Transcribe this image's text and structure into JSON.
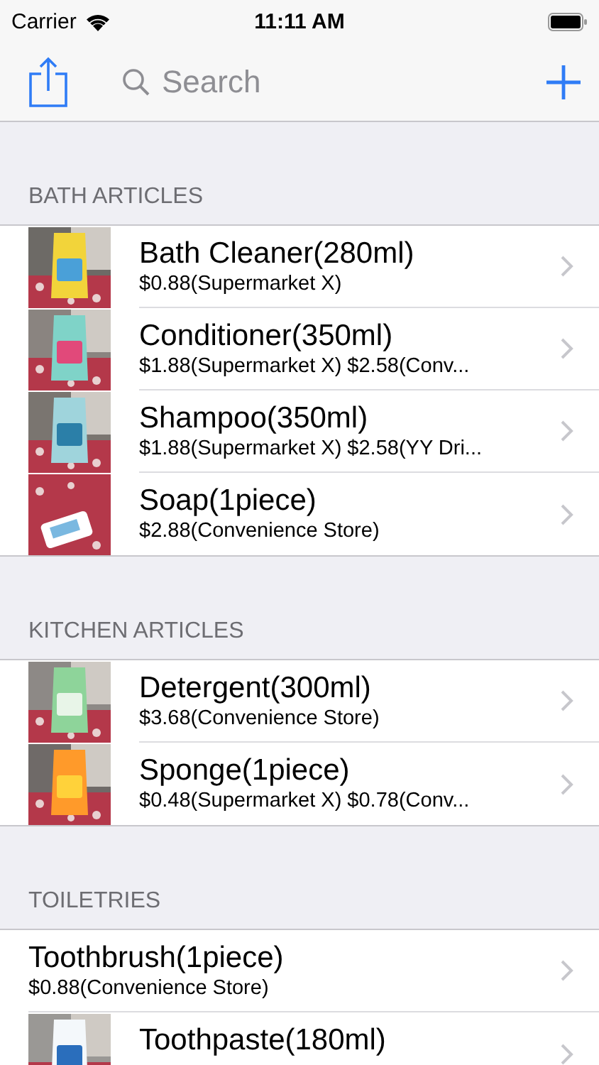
{
  "status_bar": {
    "carrier": "Carrier",
    "time": "11:11 AM"
  },
  "nav_bar": {
    "search": {
      "placeholder": "Search"
    }
  },
  "sections": [
    {
      "title": "BATH ARTICLES",
      "items": [
        {
          "kind": "picture",
          "name": "Bath Cleaner(280ml)",
          "prices": "$0.88(Supermarket X)"
        },
        {
          "kind": "picture",
          "name": "Conditioner(350ml)",
          "prices": "$1.88(Supermarket X) $2.58(Conv..."
        },
        {
          "kind": "picture",
          "name": "Shampoo(350ml)",
          "prices": "$1.88(Supermarket X) $2.58(YY Dri..."
        },
        {
          "kind": "picture",
          "name": "Soap(1piece)",
          "prices": "$2.88(Convenience Store)"
        }
      ]
    },
    {
      "title": "KITCHEN ARTICLES",
      "items": [
        {
          "kind": "picture",
          "name": "Detergent(300ml)",
          "prices": "$3.68(Convenience Store)"
        },
        {
          "kind": "picture",
          "name": "Sponge(1piece)",
          "prices": "$0.48(Supermarket X) $0.78(Conv..."
        }
      ]
    },
    {
      "title": "TOILETRIES",
      "items": [
        {
          "kind": "plain",
          "name": "Toothbrush(1piece)",
          "prices": "$0.88(Convenience Store)"
        },
        {
          "kind": "picture",
          "name": "Toothpaste(180ml)"
        }
      ]
    }
  ]
}
